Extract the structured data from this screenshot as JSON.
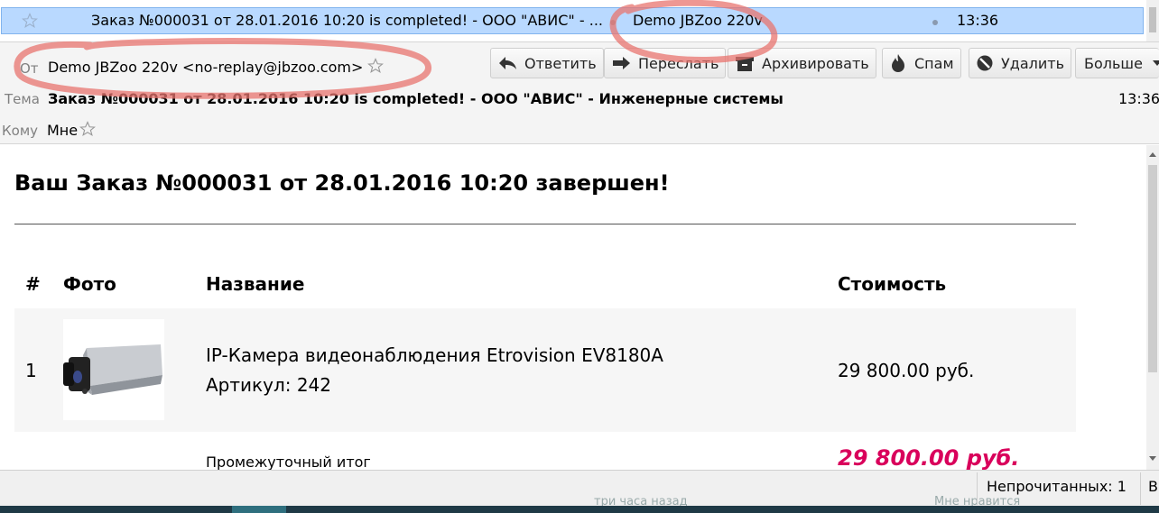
{
  "message_list": {
    "subject": "Заказ №000031 от 28.01.2016 10:20 is completed! - ООО \"АВИС\" - ...",
    "sender": "Demo JBZoo 220v",
    "time": "13:36"
  },
  "header": {
    "from_label": "От",
    "from_value": "Demo JBZoo 220v <no-replay@jbzoo.com>",
    "subject_label": "Тема",
    "subject_value": "Заказ №000031 от 28.01.2016 10:20 is completed! - ООО \"АВИС\" - Инженерные системы",
    "time": "13:36",
    "to_label": "Кому",
    "to_value": "Мне"
  },
  "toolbar": {
    "reply": "Ответить",
    "forward": "Переслать",
    "archive": "Архивировать",
    "spam": "Спам",
    "delete": "Удалить",
    "more": "Больше"
  },
  "body": {
    "title": "Ваш Заказ №000031 от 28.01.2016 10:20 завершен!",
    "columns": [
      "#",
      "Фото",
      "Название",
      "Стоимость"
    ],
    "rows": [
      {
        "num": "1",
        "name": "IP-Камера видеонаблюдения Etrovision EV8180A",
        "sku": "Артикул: 242",
        "price": "29 800.00 руб."
      }
    ],
    "subtotal_label": "Промежуточный итог",
    "subtotal_value": "29 800.00 руб."
  },
  "status": {
    "unread": "Непрочитанных: 1",
    "extra": "В",
    "behind_left": "три часа назад",
    "behind_right": "Мне нравится"
  },
  "colors": {
    "selection": "#b9d9ff",
    "price_accent": "#d9005b",
    "annotation": "#e8746f"
  }
}
